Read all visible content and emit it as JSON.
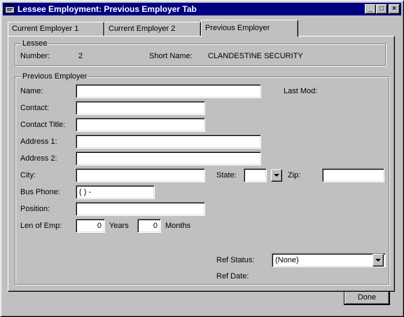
{
  "window": {
    "title": "Lessee Employment: Previous Employer Tab",
    "controls": {
      "minimize": "_",
      "maximize": "□",
      "close": "×"
    }
  },
  "tabs": [
    {
      "label": "Current Employer 1",
      "mnemonic": "1",
      "active": false
    },
    {
      "label": "Current Employer 2",
      "mnemonic": "E",
      "active": false
    },
    {
      "label": "Previous Employer",
      "mnemonic": "P",
      "active": true
    }
  ],
  "lessee": {
    "group_label": "Lessee",
    "number_label": "Number:",
    "number_value": "2",
    "short_name_label": "Short Name:",
    "short_name_value": "CLANDESTINE SECURITY"
  },
  "previous_employer": {
    "group_label": "Previous Employer",
    "name_label": "Name:",
    "name_value": "",
    "last_mod_label": "Last Mod:",
    "contact_label": "Contact:",
    "contact_value": "",
    "contact_title_label": "Contact Title:",
    "contact_title_value": "",
    "address1_label": "Address 1:",
    "address1_value": "",
    "address2_label": "Address 2:",
    "address2_value": "",
    "city_label": "City:",
    "city_value": "",
    "state_label": "State:",
    "state_value": "",
    "zip_label": "Zip:",
    "zip_value": "",
    "bus_phone_label": "Bus Phone:",
    "bus_phone_value": "(   )   -",
    "position_label": "Position:",
    "position_value": "",
    "len_emp_label": "Len of Emp:",
    "years_value": "0",
    "years_label": "Years",
    "months_value": "0",
    "months_label": "Months",
    "ref_status_label": "Ref Status:",
    "ref_status_value": "(None)",
    "ref_date_label": "Ref Date:"
  },
  "footer": {
    "done_label": "Done"
  },
  "icons": {
    "app": "app-window-icon",
    "dropdown": "chevron-down-icon"
  },
  "colors": {
    "titlebar": "#000080",
    "face": "#c0c0c0",
    "field": "#ffffff"
  }
}
